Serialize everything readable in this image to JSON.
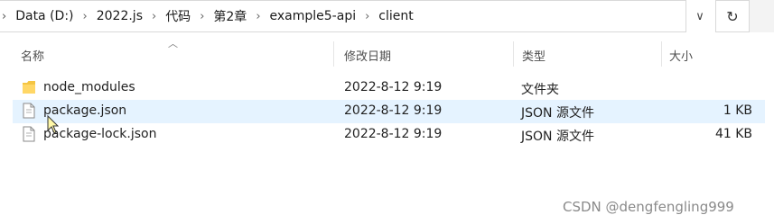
{
  "address_bar": {
    "segments": [
      "Data (D:)",
      "2022.js",
      "代码",
      "第2章",
      "example5-api",
      "client"
    ],
    "separator": "›"
  },
  "columns": {
    "name": "名称",
    "date_modified": "修改日期",
    "type": "类型",
    "size": "大小"
  },
  "files": [
    {
      "name": "node_modules",
      "date": "2022-8-12 9:19",
      "type": "文件夹",
      "size": "",
      "icon": "folder-icon"
    },
    {
      "name": "package.json",
      "date": "2022-8-12 9:19",
      "type": "JSON 源文件",
      "size": "1 KB",
      "icon": "json-file-icon",
      "selected": true
    },
    {
      "name": "package-lock.json",
      "date": "2022-8-12 9:19",
      "type": "JSON 源文件",
      "size": "41 KB",
      "icon": "json-file-icon"
    }
  ],
  "watermark": "CSDN @dengfengling999",
  "colors": {
    "selection": "#e5f3ff",
    "folder": "#f5c542"
  }
}
